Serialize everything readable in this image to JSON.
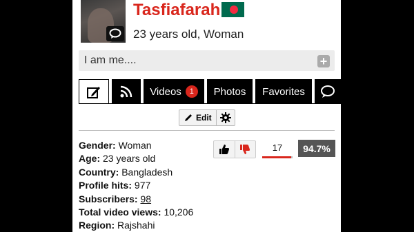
{
  "profile": {
    "name": "Tasfiafarah",
    "subtitle": "23 years old, Woman",
    "flag_colors": {
      "field": "#006a4e",
      "disc": "#f42a41"
    },
    "name_color": "#d9261c"
  },
  "about": {
    "text": "I am me....",
    "add_icon": "plus-icon"
  },
  "tabs": [
    {
      "icon": "edit-icon",
      "active": true
    },
    {
      "icon": "rss-icon"
    },
    {
      "label": "Videos",
      "badge": "1"
    },
    {
      "label": "Photos"
    },
    {
      "label": "Favorites"
    },
    {
      "icon": "chat-icon"
    }
  ],
  "toolbar": {
    "edit_label": "Edit",
    "settings_icon": "gear-icon"
  },
  "info": [
    {
      "label": "Gender:",
      "value": "Woman"
    },
    {
      "label": "Age:",
      "value": "23 years old"
    },
    {
      "label": "Country:",
      "value": "Bangladesh"
    },
    {
      "label": "Profile hits:",
      "value": "977"
    },
    {
      "label": "Subscribers:",
      "value": "98"
    },
    {
      "label": "Total video views:",
      "value": "10,206"
    },
    {
      "label": "Region:",
      "value": "Rajshahi"
    }
  ],
  "rating": {
    "votes": "17",
    "percent": "94.7%",
    "ratio": 0.947
  }
}
